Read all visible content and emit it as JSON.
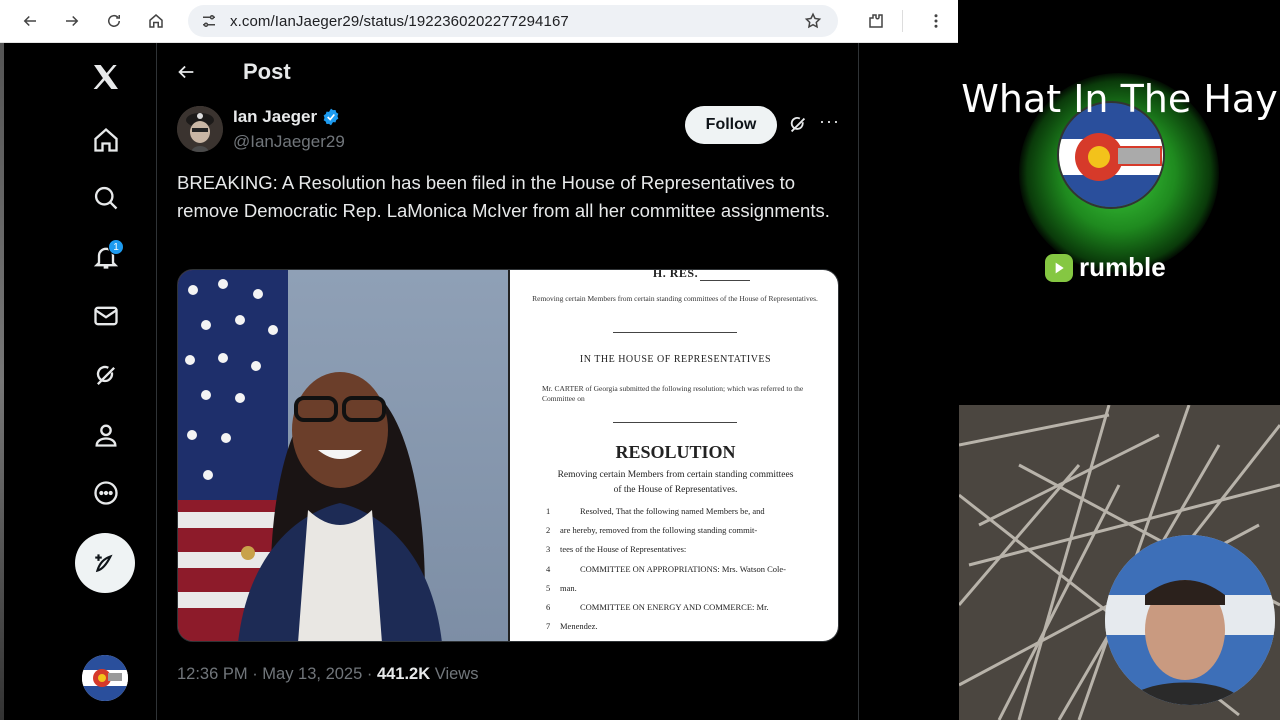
{
  "browser": {
    "url": "x.com/IanJaeger29/status/1922360202277294167"
  },
  "sidebar": {
    "notification_count": "1"
  },
  "header": {
    "title": "Post"
  },
  "post": {
    "display_name": "Ian Jaeger",
    "handle": "@IanJaeger29",
    "follow_label": "Follow",
    "more_label": "···",
    "text": "BREAKING: A Resolution has been filed in the House of Representatives to remove Democratic Rep. LaMonica McIver from all her committee assignments.",
    "timestamp": "12:36 PM · May 13, 2025 · ",
    "views_count": "441.2K",
    "views_label": " Views"
  },
  "document": {
    "header_text": "H. RES.",
    "desc": "Removing certain Members from certain standing committees of the House of Representatives.",
    "house": "IN THE HOUSE OF REPRESENTATIVES",
    "submitted": "Mr. CARTER of Georgia submitted the following resolution; which was referred to the Committee on",
    "title": "RESOLUTION",
    "subtitle_1": "Removing certain Members from certain standing committees",
    "subtitle_2": "of the House of Representatives.",
    "lines": [
      {
        "n": "1",
        "t": "Resolved, That the following named Members be, and"
      },
      {
        "n": "2",
        "t": "are hereby, removed from the following standing commit-"
      },
      {
        "n": "3",
        "t": "tees of the House of Representatives:"
      },
      {
        "n": "4",
        "t": "COMMITTEE ON APPROPRIATIONS: Mrs. Watson Cole-"
      },
      {
        "n": "5",
        "t": "man."
      },
      {
        "n": "6",
        "t": "COMMITTEE ON ENERGY AND COMMERCE: Mr."
      },
      {
        "n": "7",
        "t": "Menendez."
      }
    ]
  },
  "overlay": {
    "brand_title": "What In The Hay",
    "rumble": "rumble"
  },
  "colors": {
    "accent": "#1d9bf0",
    "rumble_green": "#85c742"
  }
}
